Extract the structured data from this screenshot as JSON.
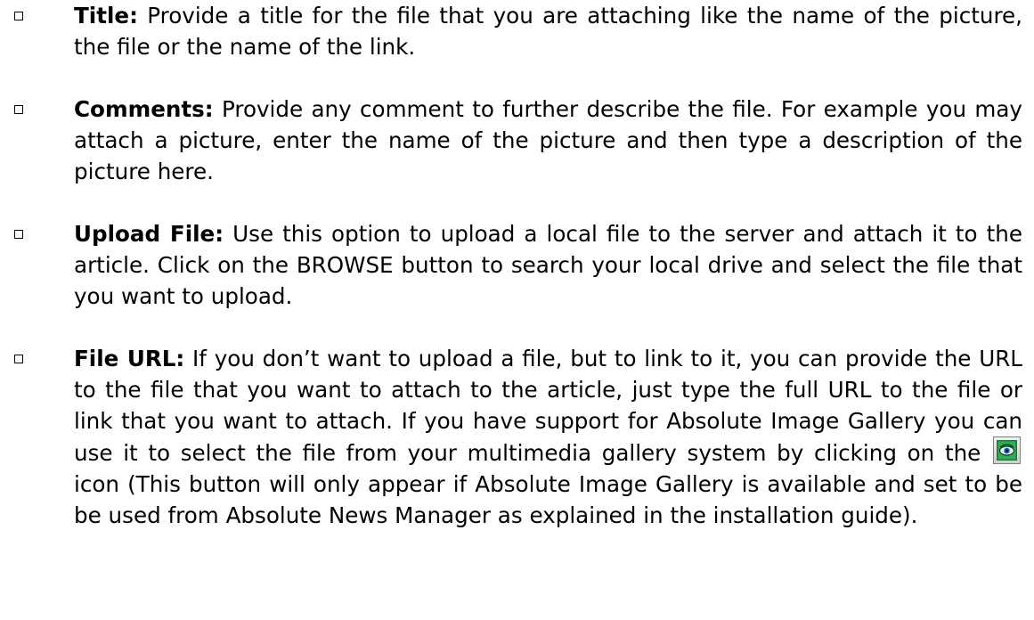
{
  "items": [
    {
      "term": "Title:",
      "text": " Provide a title for the file that you are attaching like the name of the picture, the file or the name of the link."
    },
    {
      "term": "Comments:",
      "text": " Provide any comment to further describe the file. For example you may attach a picture, enter the name of the picture and then type a description of the picture here."
    },
    {
      "term": "Upload File:",
      "text": " Use this option to upload a local file to the server and attach it to the article. Click on the BROWSE button to search your local drive and select the file that you want to upload."
    },
    {
      "term": "File URL:",
      "text_before_icon": " If you don’t want to upload a file, but to link to it, you can provide the URL to the file that you want to attach to the article, just type the full URL to the file or link that you want to attach. If you have support for Absolute Image Gallery you can use it to select the file from your multimedia gallery system by clicking on the ",
      "icon": "gallery-eye-icon",
      "text_after_icon": " icon (This button will only appear if Absolute Image Gallery is available and set to be be used from Absolute News Manager as explained in the installation guide)."
    }
  ]
}
